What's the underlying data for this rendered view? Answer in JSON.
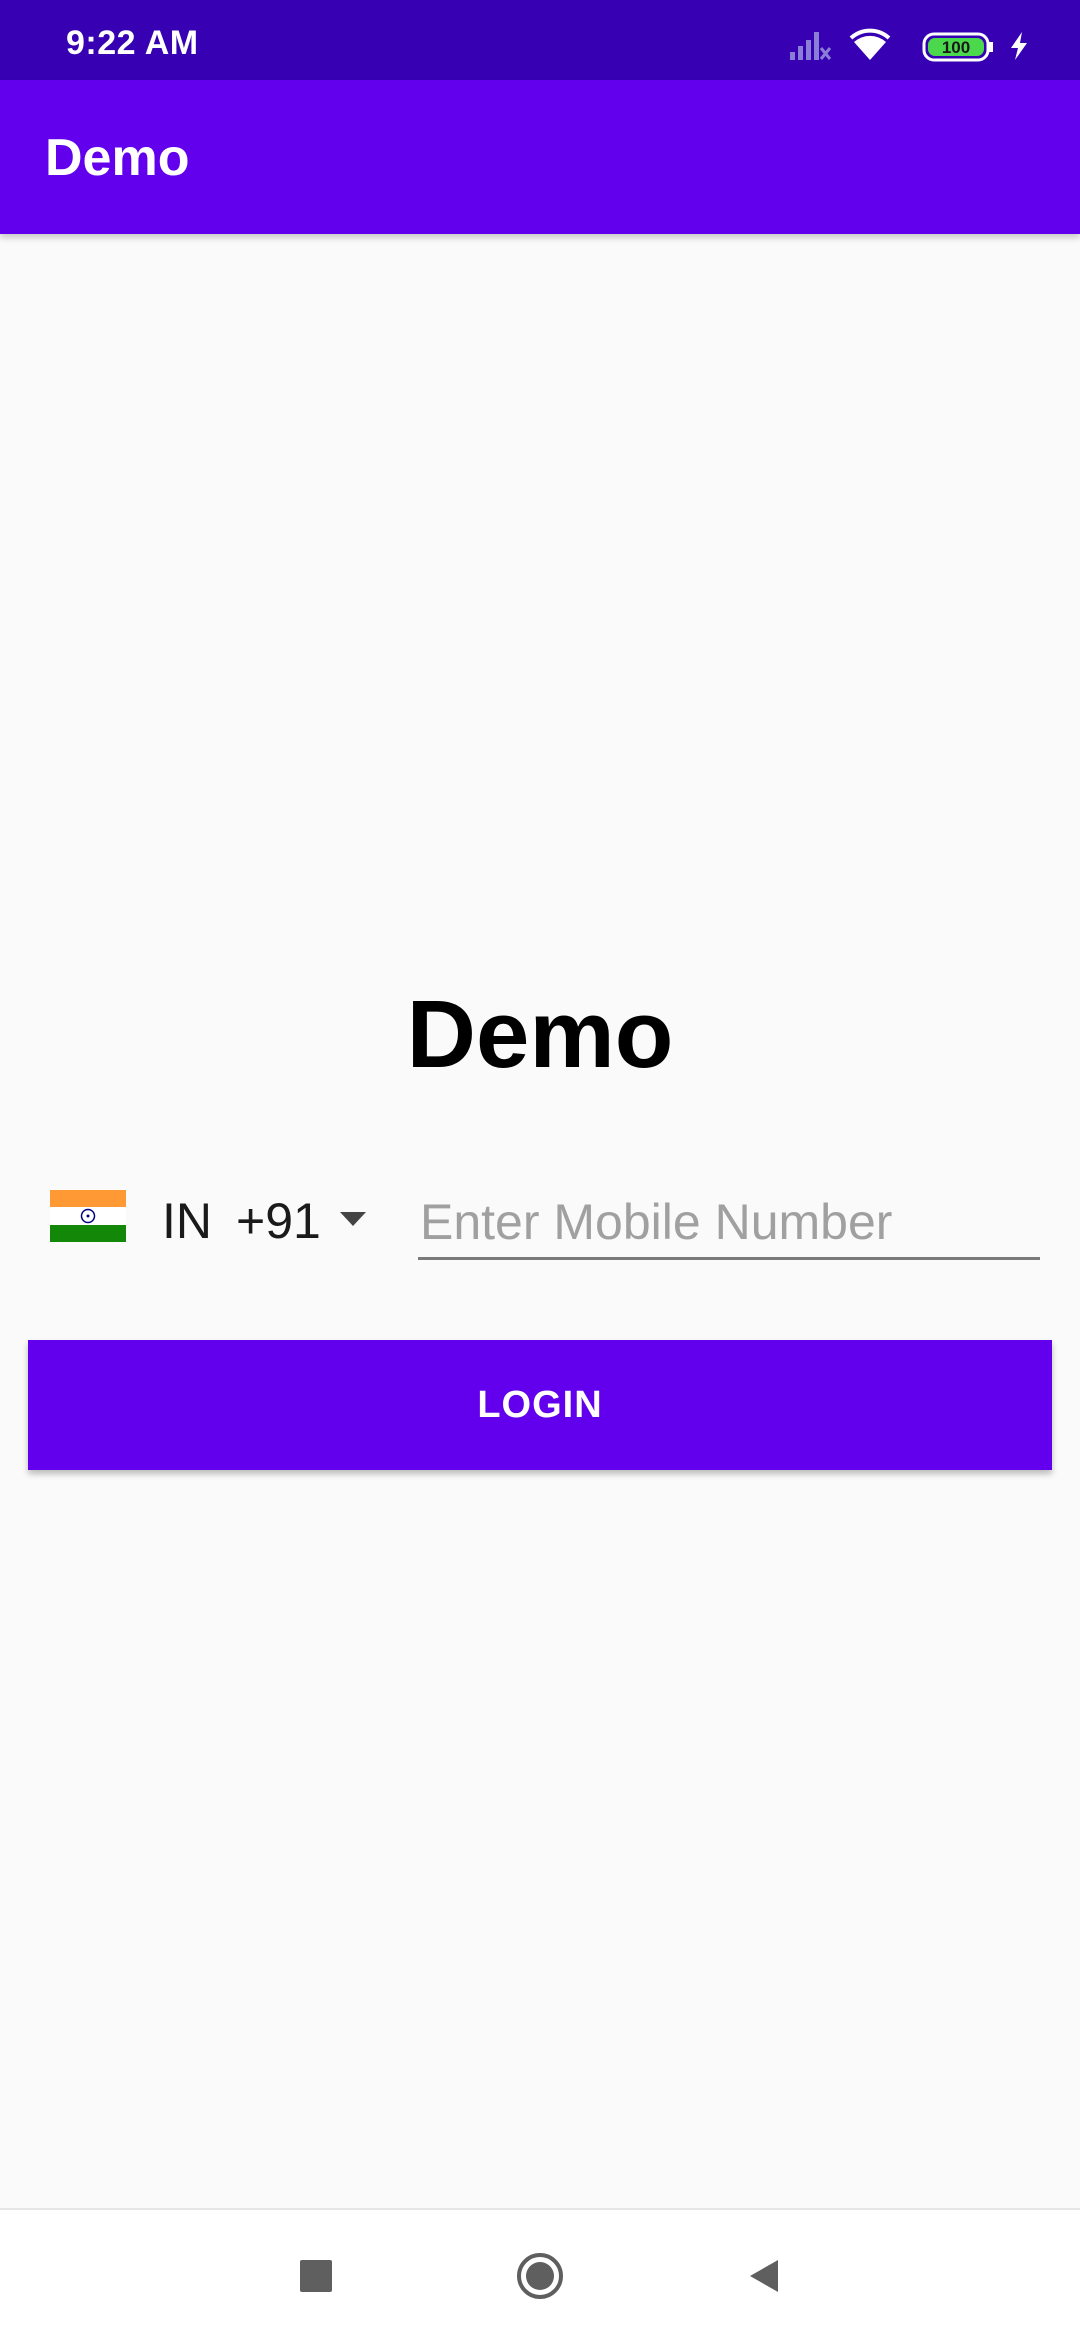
{
  "status_bar": {
    "time": "9:22 AM",
    "battery": "100",
    "icons": [
      "signal-icon",
      "wifi-icon",
      "battery-icon",
      "charging-icon"
    ]
  },
  "app_bar": {
    "title": "Demo"
  },
  "main": {
    "title": "Demo",
    "country_picker": {
      "flag": "india-flag-icon",
      "country_code": "IN",
      "dial_code": "+91"
    },
    "mobile_input": {
      "value": "",
      "placeholder": "Enter Mobile Number"
    },
    "login_button": {
      "label": "LOGIN"
    }
  },
  "nav_bar": {
    "buttons": [
      "recents-icon",
      "home-icon",
      "back-icon"
    ]
  },
  "colors": {
    "primary": "#6200EE",
    "primary_dark": "#3700B3",
    "background": "#FAFAFA"
  }
}
